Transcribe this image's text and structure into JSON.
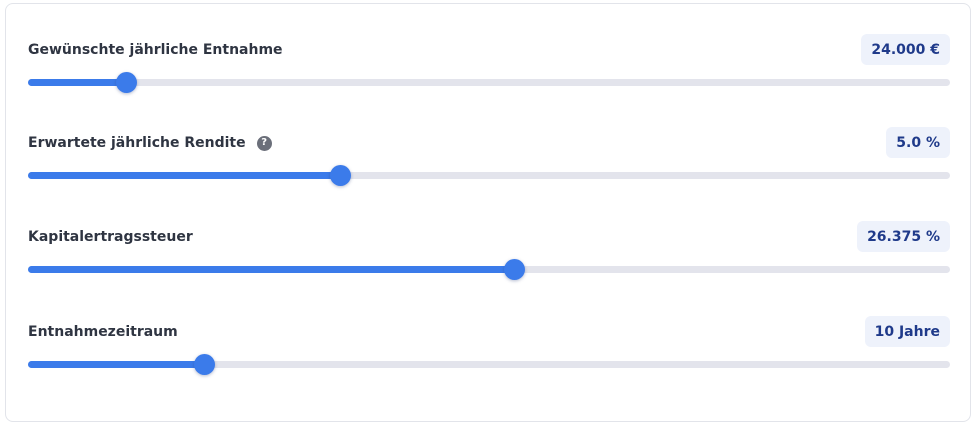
{
  "colors": {
    "accent": "#3b7bea",
    "track": "#e3e4ec",
    "badge_bg": "#eef2fb",
    "badge_text": "#1f3a8a",
    "label_text": "#2f3542",
    "help_icon_bg": "#6b6f7a"
  },
  "sliders": [
    {
      "label": "Gewünschte jährliche Entnahme",
      "value_display": "24.000 €",
      "fraction": 0.106,
      "has_help": false
    },
    {
      "label": "Erwartete jährliche Rendite",
      "value_display": "5.0 %",
      "fraction": 0.338,
      "has_help": true,
      "help_icon": "question-circle-icon",
      "help_glyph": "?"
    },
    {
      "label": "Kapitalertragssteuer",
      "value_display": "26.375 %",
      "fraction": 0.527,
      "has_help": false
    },
    {
      "label": "Entnahmezeitraum",
      "value_display": "10 Jahre",
      "fraction": 0.191,
      "has_help": false
    }
  ]
}
